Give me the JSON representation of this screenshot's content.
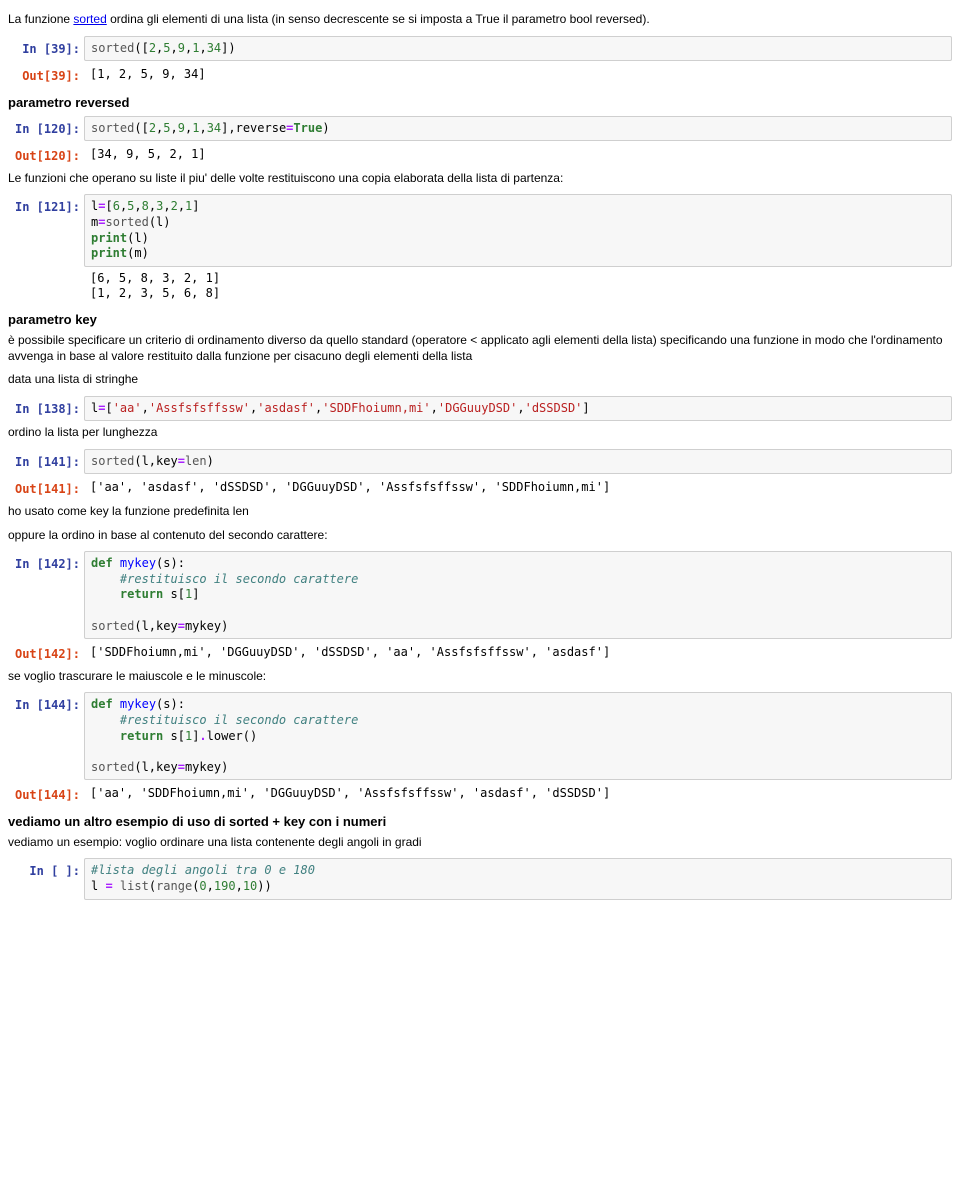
{
  "p1a": "La funzione ",
  "p1link": "sorted",
  "p1b": " ordina gli elementi di una lista (in senso decrescente se si imposta a True il parametro bool reversed).",
  "in39_p": "In [39]:",
  "in39_code": "sorted([2,5,9,1,34])",
  "out39_p": "Out[39]:",
  "out39_v": "[1, 2, 5, 9, 34]",
  "h_reversed": "parametro reversed",
  "in120_p": "In [120]:",
  "in120_code": "sorted([2,5,9,1,34],reverse=True)",
  "out120_p": "Out[120]:",
  "out120_v": "[34, 9, 5, 2, 1]",
  "p2": "Le funzioni che operano su liste il piu' delle volte restituiscono una copia elaborata della lista di partenza:",
  "in121_p": "In [121]:",
  "in121_l1": "l=[6,5,8,3,2,1]",
  "in121_l2": "m=sorted(l)",
  "in121_l3": "print(l)",
  "in121_l4": "print(m)",
  "stdout121": "[6, 5, 8, 3, 2, 1]\n[1, 2, 3, 5, 6, 8]",
  "h_key": "parametro key",
  "p3": "è possibile specificare un criterio di ordinamento diverso da quello standard (operatore < applicato agli elementi della lista) specificando una funzione in modo che l'ordinamento avvenga in base al valore restituito dalla funzione per cisacuno degli elementi della lista",
  "p4": "data una lista di stringhe",
  "in138_p": "In [138]:",
  "in138_code": "l=['aa','Assfsfsffssw','asdasf','SDDFhoiumn,mi','DGGuuyDSD','dSSDSD']",
  "p5": "ordino la lista per lunghezza",
  "in141_p": "In [141]:",
  "in141_code": "sorted(l,key=len)",
  "out141_p": "Out[141]:",
  "out141_v": "['aa', 'asdasf', 'dSSDSD', 'DGGuuyDSD', 'Assfsfsffssw', 'SDDFhoiumn,mi']",
  "p6": "ho usato come key la funzione predefinita len",
  "p7": "oppure la ordino in base al contenuto del secondo carattere:",
  "in142_p": "In [142]:",
  "in142_l1": "def mykey(s):",
  "in142_l2": "    #restituisco il secondo carattere",
  "in142_l3": "    return s[1]",
  "in142_l4": "",
  "in142_l5": "sorted(l,key=mykey)",
  "out142_p": "Out[142]:",
  "out142_v": "['SDDFhoiumn,mi', 'DGGuuyDSD', 'dSSDSD', 'aa', 'Assfsfsffssw', 'asdasf']",
  "p8": "se voglio trascurare le maiuscole e le minuscole:",
  "in144_p": "In [144]:",
  "in144_l1": "def mykey(s):",
  "in144_l2": "    #restituisco il secondo carattere",
  "in144_l3": "    return s[1].lower()",
  "in144_l4": "",
  "in144_l5": "sorted(l,key=mykey)",
  "out144_p": "Out[144]:",
  "out144_v": "['aa', 'SDDFhoiumn,mi', 'DGGuuyDSD', 'Assfsfsffssw', 'asdasf', 'dSSDSD']",
  "h_num": "vediamo un altro esempio di uso di sorted + key con i numeri",
  "p9": "vediamo un esempio: voglio ordinare una lista contenente degli angoli in gradi",
  "in_empty_p": "In [ ]:",
  "in_empty_l1": "#lista degli angoli tra 0 e 180",
  "in_empty_l2": "l = list(range(0,190,10))"
}
